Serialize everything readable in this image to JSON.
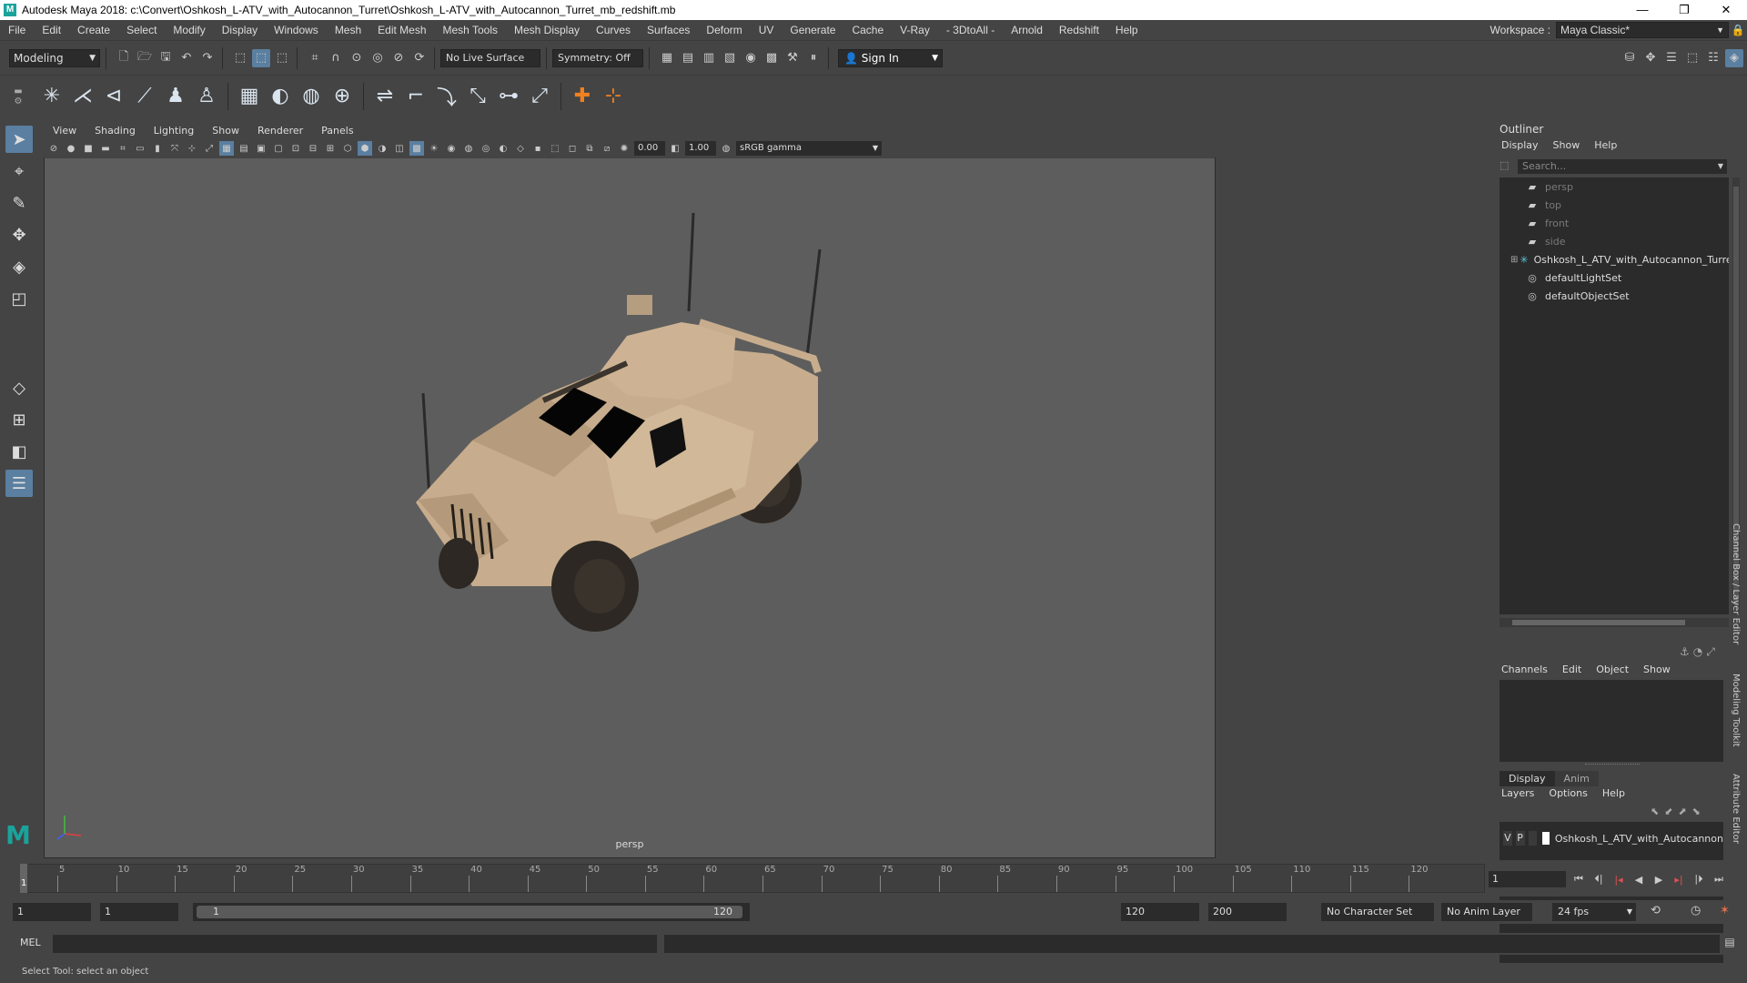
{
  "window": {
    "title": "Autodesk Maya 2018: c:\\Convert\\Oshkosh_L-ATV_with_Autocannon_Turret\\Oshkosh_L-ATV_with_Autocannon_Turret_mb_redshift.mb",
    "minimize": "—",
    "maximize": "❐",
    "close": "✕"
  },
  "menubar": {
    "items": [
      "File",
      "Edit",
      "Create",
      "Select",
      "Modify",
      "Display",
      "Windows",
      "Mesh",
      "Edit Mesh",
      "Mesh Tools",
      "Mesh Display",
      "Curves",
      "Surfaces",
      "Deform",
      "UV",
      "Generate",
      "Cache",
      "V-Ray",
      "- 3DtoAll -",
      "Arnold",
      "Redshift",
      "Help"
    ],
    "workspace_label": "Workspace :",
    "workspace_value": "Maya Classic*"
  },
  "statusline": {
    "mode": "Modeling",
    "live_surface": "No Live Surface",
    "symmetry": "Symmetry: Off",
    "sign_in": "Sign In"
  },
  "panel": {
    "menus": [
      "View",
      "Shading",
      "Lighting",
      "Show",
      "Renderer",
      "Panels"
    ],
    "exposure": "0.00",
    "gamma": "1.00",
    "color_space": "sRGB gamma",
    "camera": "persp"
  },
  "outliner": {
    "title": "Outliner",
    "menus": [
      "Display",
      "Show",
      "Help"
    ],
    "search_placeholder": "Search...",
    "items": [
      {
        "label": "persp",
        "icon": "camera-icon",
        "dim": true
      },
      {
        "label": "top",
        "icon": "camera-icon",
        "dim": true
      },
      {
        "label": "front",
        "icon": "camera-icon",
        "dim": true
      },
      {
        "label": "side",
        "icon": "camera-icon",
        "dim": true
      },
      {
        "label": "Oshkosh_L_ATV_with_Autocannon_Turret",
        "icon": "assembly-icon",
        "dim": false
      },
      {
        "label": "defaultLightSet",
        "icon": "set-icon",
        "dim": false
      },
      {
        "label": "defaultObjectSet",
        "icon": "set-icon",
        "dim": false
      }
    ]
  },
  "channel_box": {
    "menus": [
      "Channels",
      "Edit",
      "Object",
      "Show"
    ]
  },
  "layer_editor": {
    "tabs": [
      "Display",
      "Anim"
    ],
    "menus": [
      "Layers",
      "Options",
      "Help"
    ],
    "layer": {
      "v": "V",
      "p": "P",
      "name": "Oshkosh_L_ATV_with_Autocannon"
    }
  },
  "side_tabs": [
    "Channel Box / Layer Editor",
    "Modeling Toolkit",
    "Attribute Editor"
  ],
  "timeline": {
    "labels": [
      "5",
      "10",
      "15",
      "20",
      "25",
      "30",
      "35",
      "40",
      "45",
      "50",
      "55",
      "60",
      "65",
      "70",
      "75",
      "80",
      "85",
      "90",
      "95",
      "100",
      "105",
      "110",
      "115",
      "120"
    ],
    "current_marker": "1",
    "current_frame": "1"
  },
  "range": {
    "start": "1",
    "playback_start": "1",
    "bar_start": "1",
    "bar_end": "120",
    "playback_end": "120",
    "end": "200",
    "character_set": "No Character Set",
    "anim_layer": "No Anim Layer",
    "fps": "24 fps"
  },
  "command": {
    "mel_label": "MEL"
  },
  "help_line": "Select Tool: select an object",
  "colors": {
    "accent": "#5a7fa0",
    "maya_logo": "#1aa39b",
    "viewport_bg": "#5d5d5d",
    "vehicle": "#c7ad8d"
  }
}
